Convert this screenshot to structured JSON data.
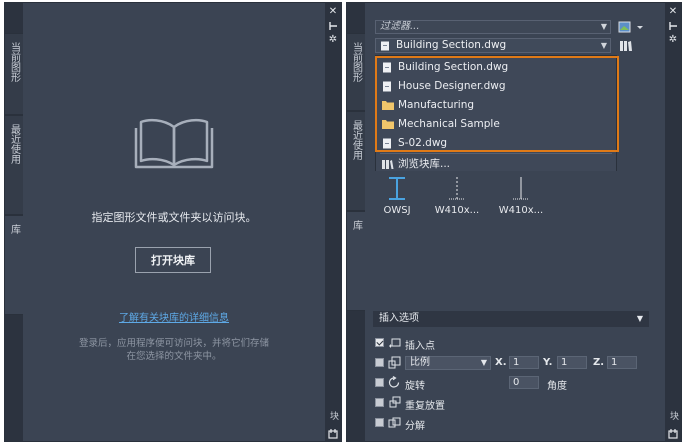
{
  "left_panel": {
    "tabs": [
      "当前图形",
      "最近使用",
      "库"
    ],
    "prompt": "指定图形文件或文件夹以访问块。",
    "open_button": "打开块库",
    "learn_link": "了解有关块库的详细信息",
    "login_info_line1": "登录后，应用程序便可访问块，并将它们存储",
    "login_info_line2": "在您选择的文件夹中。",
    "side_label": "块"
  },
  "right_panel": {
    "tabs": [
      "当前图形",
      "最近使用",
      "库"
    ],
    "filter_placeholder": "过滤器...",
    "selected_library": "Building Section.dwg",
    "dropdown_items": [
      {
        "label": "Building Section.dwg",
        "icon": "dwg-file-icon"
      },
      {
        "label": "House Designer.dwg",
        "icon": "dwg-file-icon"
      },
      {
        "label": "Manufacturing",
        "icon": "folder-icon"
      },
      {
        "label": "Mechanical Sample",
        "icon": "folder-icon"
      },
      {
        "label": "S-02.dwg",
        "icon": "dwg-file-icon"
      }
    ],
    "browse_label": "浏览块库...",
    "blocks": [
      "OWSJ",
      "W410x...",
      "W410x..."
    ],
    "insert_options_header": "插入选项",
    "insert_point_label": "插入点",
    "scale_label": "比例",
    "x_label": "X.",
    "y_label": "Y.",
    "z_label": "Z.",
    "x_value": "1",
    "y_value": "1",
    "z_value": "1",
    "rotation_label": "旋转",
    "rotation_value": "0",
    "angle_label": "角度",
    "repeat_label": "重复放置",
    "explode_label": "分解",
    "side_label": "块"
  },
  "colors": {
    "panel_bg": "#3b4453",
    "highlight_border": "#e07a17",
    "link": "#5ea9e6",
    "block_blue": "#4aa3e0"
  }
}
